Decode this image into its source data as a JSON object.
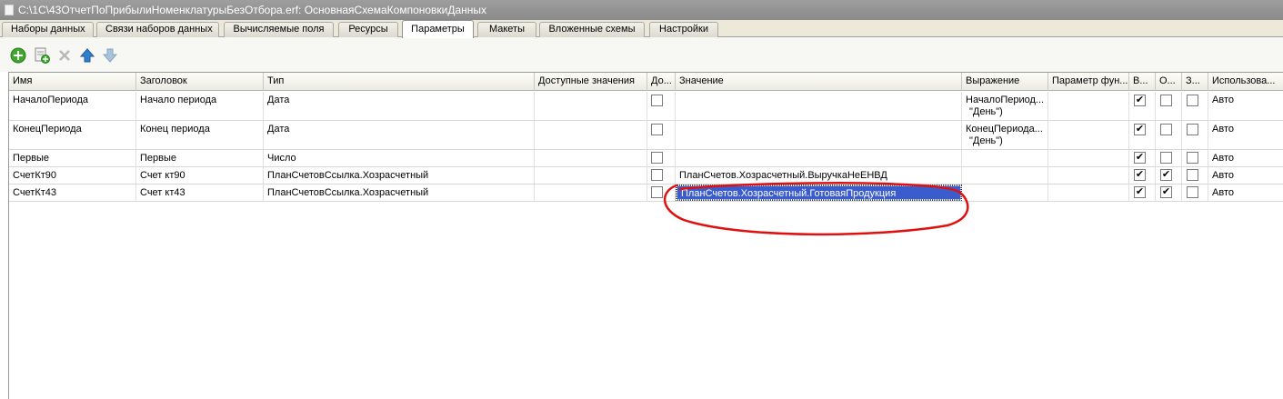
{
  "window": {
    "title": "C:\\1C\\43ОтчетПоПрибылиНоменклатурыБезОтбора.erf: ОсновнаяСхемаКомпоновкиДанных"
  },
  "tabs": [
    {
      "label": "Наборы данных"
    },
    {
      "label": "Связи наборов данных"
    },
    {
      "label": "Вычисляемые поля"
    },
    {
      "label": "Ресурсы"
    },
    {
      "label": "Параметры"
    },
    {
      "label": "Макеты"
    },
    {
      "label": "Вложенные схемы"
    },
    {
      "label": "Настройки"
    }
  ],
  "active_tab": "Параметры",
  "toolbar": {
    "icons": [
      "add-icon",
      "add-copy-icon",
      "delete-icon",
      "move-up-icon",
      "move-down-icon"
    ]
  },
  "grid": {
    "columns": [
      "Имя",
      "Заголовок",
      "Тип",
      "Доступные значения",
      "До...",
      "Значение",
      "Выражение",
      "Параметр фун...",
      "В...",
      "О...",
      "З...",
      "Использова..."
    ],
    "rows": [
      {
        "name": "НачалоПериода",
        "title": "Начало периода",
        "type": "Дата",
        "available": "",
        "value": "",
        "expression": [
          "НачалоПериод...",
          "\"День\")"
        ],
        "func_param": "",
        "c1": true,
        "c2": false,
        "c3": false,
        "usage": "Авто"
      },
      {
        "name": "КонецПериода",
        "title": "Конец периода",
        "type": "Дата",
        "available": "",
        "value": "",
        "expression": [
          "КонецПериода...",
          "\"День\")"
        ],
        "func_param": "",
        "c1": true,
        "c2": false,
        "c3": false,
        "usage": "Авто"
      },
      {
        "name": "Первые",
        "title": "Первые",
        "type": "Число",
        "available": "",
        "value": "",
        "expression": [
          "",
          ""
        ],
        "func_param": "",
        "c1": true,
        "c2": false,
        "c3": false,
        "usage": "Авто"
      },
      {
        "name": "СчетКт90",
        "title": "Счет кт90",
        "type": "ПланСчетовСсылка.Хозрасчетный",
        "available": "",
        "value": "ПланСчетов.Хозрасчетный.ВыручкаНеЕНВД",
        "expression": [
          "",
          ""
        ],
        "func_param": "",
        "c1": true,
        "c2": true,
        "c3": false,
        "usage": "Авто"
      },
      {
        "name": "СчетКт43",
        "title": "Счет кт43",
        "type": "ПланСчетовСсылка.Хозрасчетный",
        "available": "",
        "value": "ПланСчетов.Хозрасчетный.ГотоваяПродукция",
        "expression": [
          "",
          ""
        ],
        "func_param": "",
        "c1": true,
        "c2": true,
        "c3": false,
        "usage": "Авто"
      }
    ]
  },
  "colors": {
    "selection": "#3a5ccc",
    "annotation": "#e01010",
    "titlebar": "#8f8f8f"
  }
}
